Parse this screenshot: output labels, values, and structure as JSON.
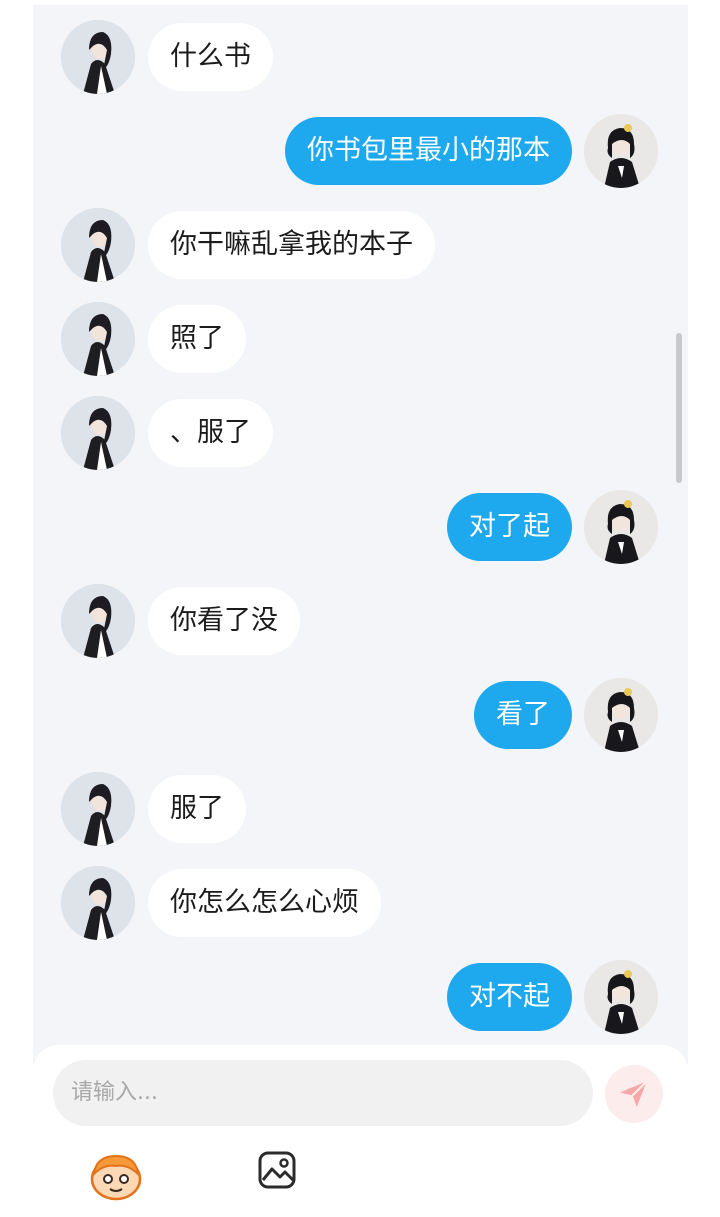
{
  "messages": [
    {
      "side": "in",
      "text": "什么书"
    },
    {
      "side": "out",
      "text": "你书包里最小的那本"
    },
    {
      "side": "in",
      "text": "你干嘛乱拿我的本子"
    },
    {
      "side": "in",
      "text": "照了"
    },
    {
      "side": "in",
      "text": "、服了"
    },
    {
      "side": "out",
      "text": "对了起"
    },
    {
      "side": "in",
      "text": "你看了没"
    },
    {
      "side": "out",
      "text": "看了"
    },
    {
      "side": "in",
      "text": "服了"
    },
    {
      "side": "in",
      "text": "你怎么怎么心烦"
    },
    {
      "side": "out",
      "text": "对不起"
    }
  ],
  "composer": {
    "placeholder": "请输入...",
    "send_icon": "paper-plane-icon",
    "tools": [
      "sticker-face-icon",
      "image-icon"
    ]
  },
  "colors": {
    "outgoing_bubble": "#1ea9ee",
    "incoming_bubble": "#ffffff",
    "chat_background": "#f3f5f8",
    "send_button_bg": "#fdecec",
    "send_icon": "#f7a7a7",
    "sticker_icon": "#f59a36"
  }
}
